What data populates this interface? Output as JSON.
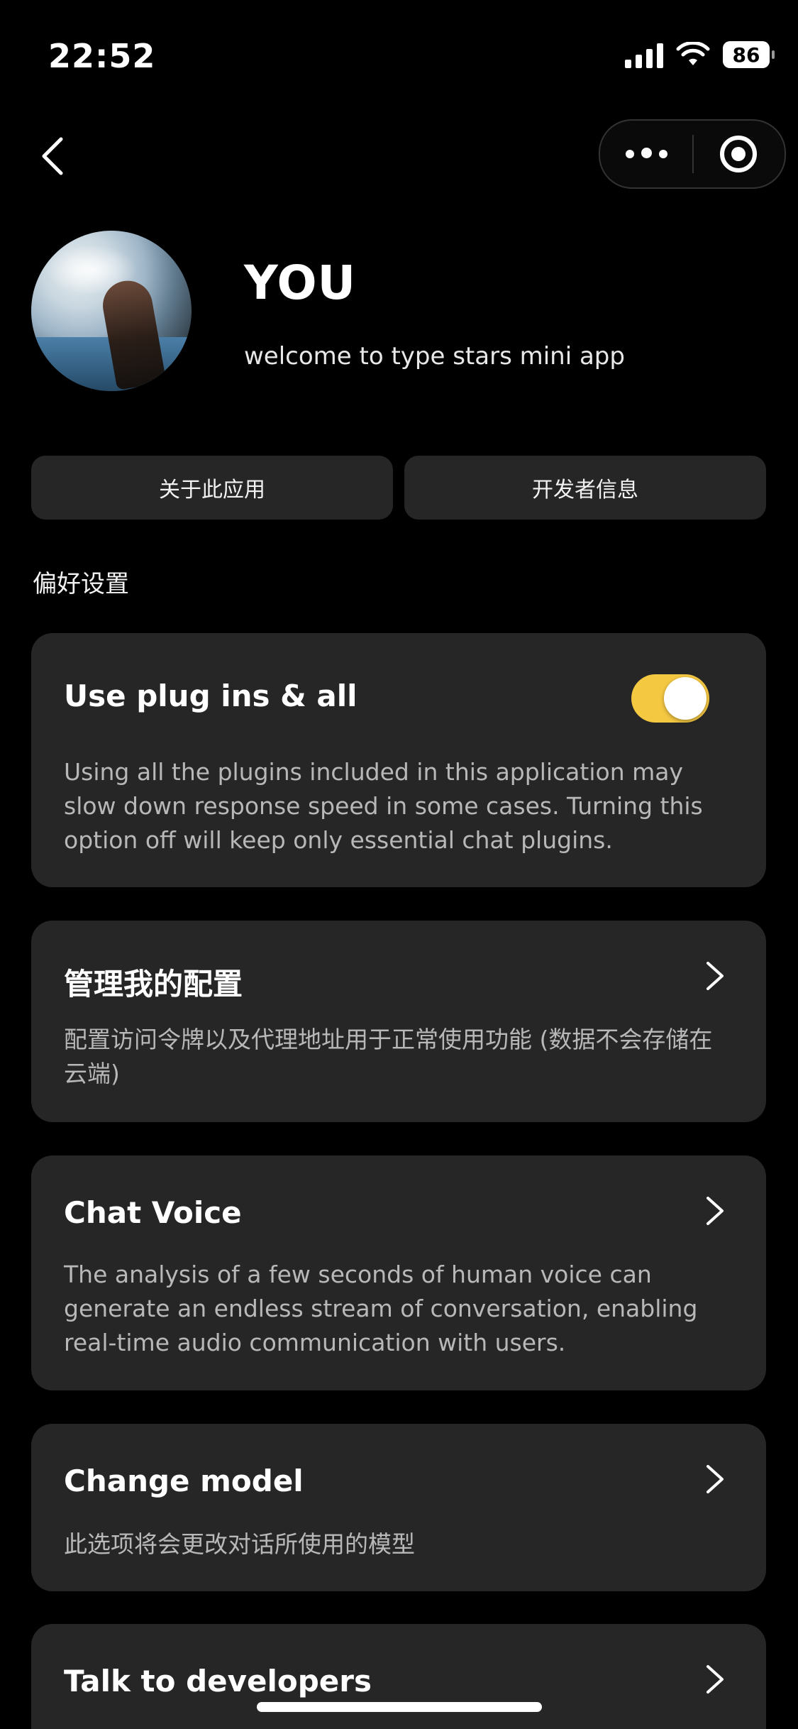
{
  "status_bar": {
    "time": "22:52",
    "battery": "86"
  },
  "nav": {
    "back_icon": "chevron-left-icon",
    "more_icon": "more-dots-icon",
    "close_icon": "target-circle-icon"
  },
  "profile": {
    "name": "YOU",
    "subtitle": "welcome to type stars mini app"
  },
  "actions": {
    "about_label": "关于此应用",
    "developer_label": "开发者信息"
  },
  "section": {
    "title": "偏好设置"
  },
  "cards": [
    {
      "title": "Use plug ins & all",
      "description": "Using all the plugins included in this application may slow down response speed in some cases. Turning this option off will keep only essential chat plugins.",
      "toggle_on": true
    },
    {
      "title": "管理我的配置",
      "description": "配置访问令牌以及代理地址用于正常使用功能 (数据不会存储在云端)"
    },
    {
      "title": "Chat Voice",
      "description": "The analysis of a few seconds of human voice can generate an endless stream of conversation, enabling real-time audio communication with users."
    },
    {
      "title": "Change model",
      "description": "此选项将会更改对话所使用的模型"
    },
    {
      "title": "Talk to developers",
      "description": ""
    }
  ],
  "colors": {
    "background": "#000000",
    "card": "#262626",
    "accent_toggle": "#F5C842"
  }
}
